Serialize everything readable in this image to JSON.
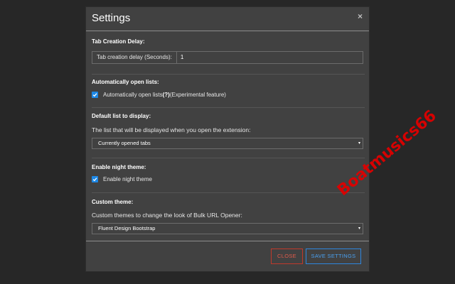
{
  "modal": {
    "title": "Settings",
    "close_icon": "×"
  },
  "sections": {
    "tab_delay": {
      "title": "Tab Creation Delay:",
      "addon_label": "Tab creation delay (Seconds):",
      "value": "1"
    },
    "auto_open": {
      "title": "Automatically open lists:",
      "checkbox_label": "Automatically open lists",
      "checkbox_help": "(?)",
      "checkbox_note": "(Experimental feature)",
      "checked": true
    },
    "default_list": {
      "title": "Default list to display:",
      "description": "The list that will be displayed when you open the extension:",
      "selected": "Currently opened tabs"
    },
    "night_theme": {
      "title": "Enable night theme:",
      "checkbox_label": "Enable night theme",
      "checked": true
    },
    "custom_theme": {
      "title": "Custom theme:",
      "description": "Custom themes to change the look of Bulk URL Opener:",
      "selected": "Fluent Design Bootstrap"
    }
  },
  "footer": {
    "close_label": "CLOSE",
    "save_label": "SAVE SETTINGS"
  },
  "watermark": "Boatmusics66",
  "colors": {
    "background": "#272727",
    "modal": "#414141",
    "accent": "#1e88e5",
    "danger": "#c0392b",
    "primary": "#2e86de"
  }
}
